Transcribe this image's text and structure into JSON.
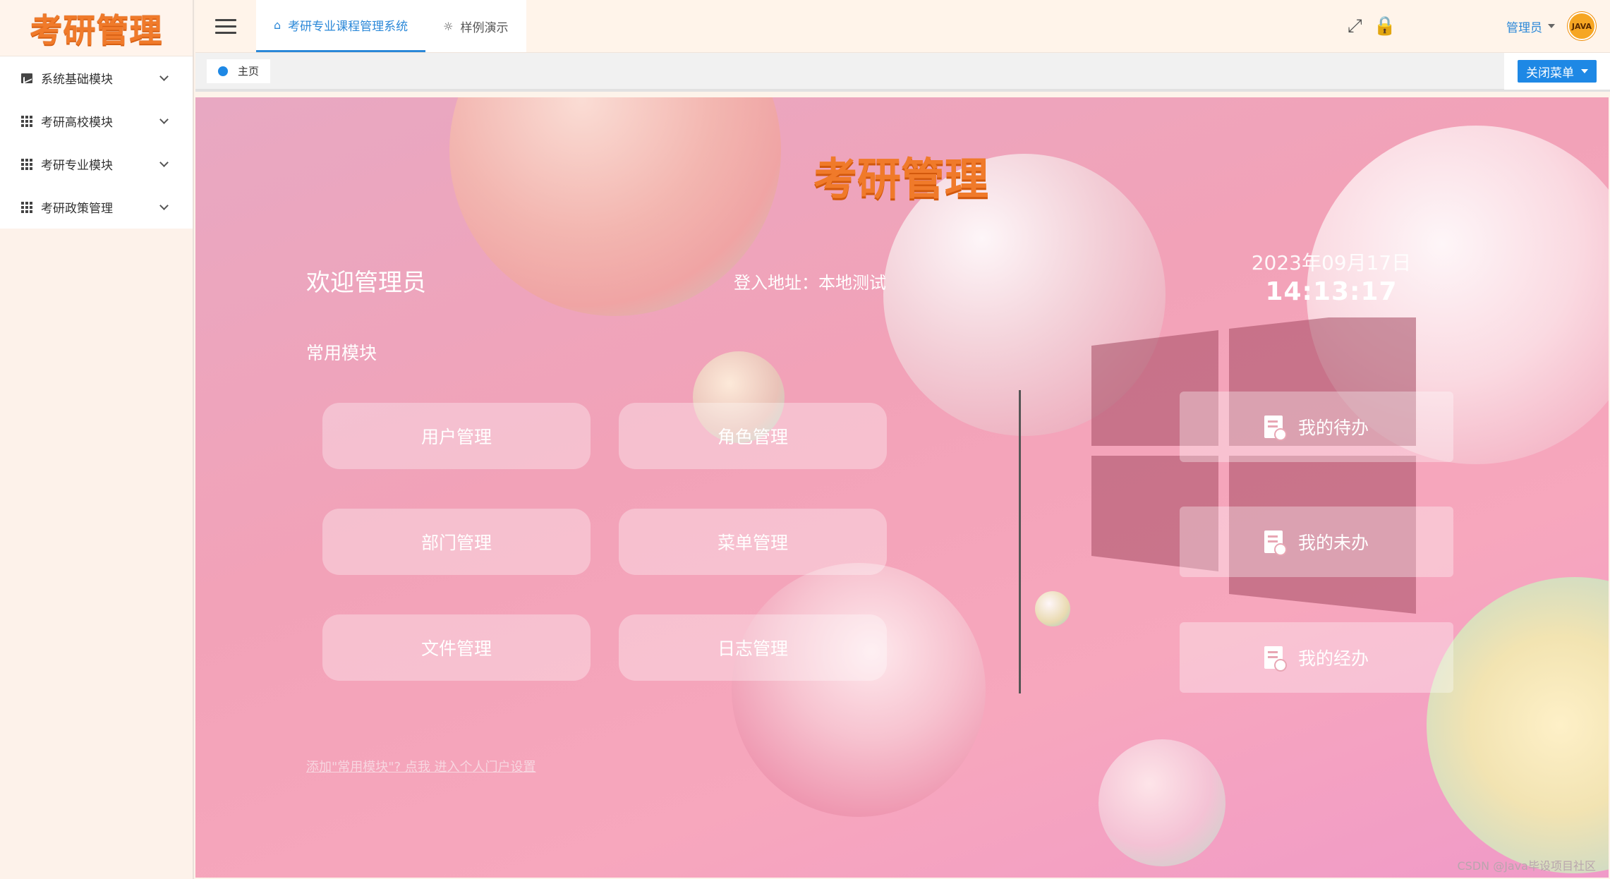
{
  "sidebar": {
    "logo_text": "考研管理",
    "items": [
      {
        "label": "系统基础模块",
        "icon": "chart-icon"
      },
      {
        "label": "考研高校模块",
        "icon": "grid-icon"
      },
      {
        "label": "考研专业模块",
        "icon": "grid-icon"
      },
      {
        "label": "考研政策管理",
        "icon": "grid-icon"
      }
    ]
  },
  "header": {
    "tabs": [
      {
        "label": "考研专业课程管理系统",
        "icon": "home-icon",
        "active": true
      },
      {
        "label": "样例演示",
        "icon": "bulb-icon",
        "active": false
      }
    ],
    "admin_label": "管理员",
    "avatar_text": "JAVA"
  },
  "breadcrumb": {
    "home_label": "主页",
    "close_menu_label": "关闭菜单"
  },
  "main": {
    "logo_text": "考研管理",
    "welcome": "欢迎管理员",
    "login_address": "登入地址：本地测试",
    "date": "2023年09月17日",
    "time": "14:13:17",
    "common_title": "常用模块",
    "modules": [
      "用户管理",
      "角色管理",
      "部门管理",
      "菜单管理",
      "文件管理",
      "日志管理"
    ],
    "todo": [
      "我的待办",
      "我的未办",
      "我的经办"
    ],
    "add_link": "添加\"常用模块\"? 点我 进入个人门户设置",
    "watermark": "CSDN @Java毕设项目社区"
  },
  "colors": {
    "accent": "#2b88d8",
    "logo": "#f07a2a",
    "close_button": "#1e88e5"
  }
}
